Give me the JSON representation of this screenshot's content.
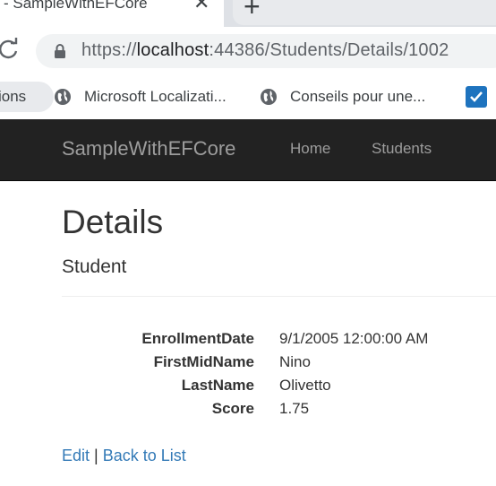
{
  "browser": {
    "tab": {
      "title": "- SampleWithEFCore",
      "close_glyph": "✕",
      "new_tab_glyph": "+"
    },
    "address": {
      "scheme": "https://",
      "host": "localhost",
      "rest": ":44386/Students/Details/1002"
    },
    "bookmarks": [
      {
        "label": "ions",
        "icon": "none"
      },
      {
        "label": "Microsoft Localizati...",
        "icon": "globe-icon"
      },
      {
        "label": "Conseils pour une...",
        "icon": "globe-icon"
      },
      {
        "label": "",
        "icon": "app-icon"
      }
    ]
  },
  "navbar": {
    "brand": "SampleWithEFCore",
    "links": [
      "Home",
      "Students"
    ]
  },
  "page": {
    "title": "Details",
    "subtitle": "Student",
    "fields": [
      {
        "label": "EnrollmentDate",
        "value": "9/1/2005 12:00:00 AM"
      },
      {
        "label": "FirstMidName",
        "value": "Nino"
      },
      {
        "label": "LastName",
        "value": "Olivetto"
      },
      {
        "label": "Score",
        "value": "1.75"
      }
    ],
    "actions": {
      "edit": "Edit",
      "separator": "|",
      "back": "Back to List"
    }
  },
  "colors": {
    "navbar_bg": "#222222",
    "navbar_text": "#9d9d9d",
    "link": "#337ab7",
    "text": "#333333"
  }
}
